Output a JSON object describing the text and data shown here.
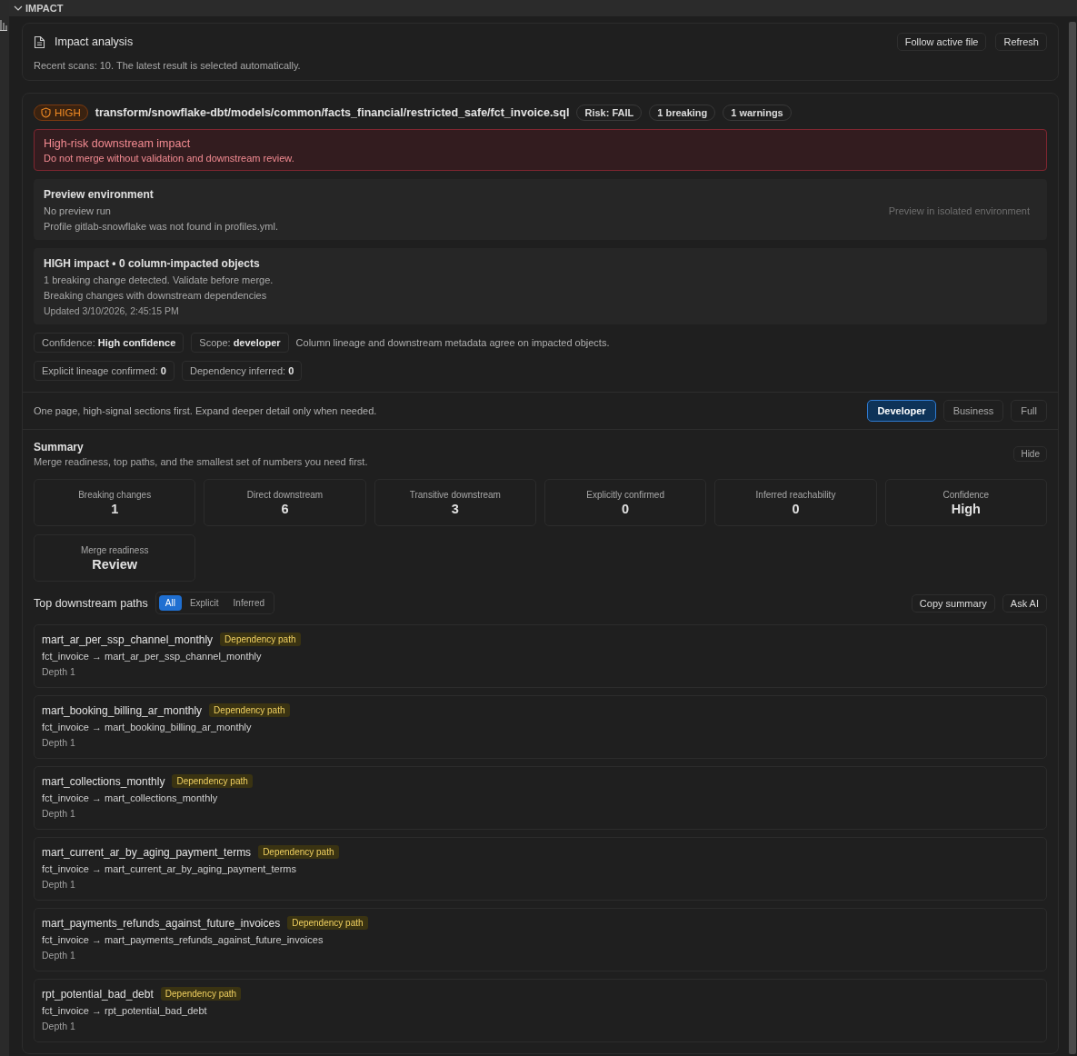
{
  "section": {
    "title": "IMPACT",
    "expanded": true
  },
  "header": {
    "title": "Impact analysis",
    "subtitle": "Recent scans: 10. The latest result is selected automatically.",
    "buttons": [
      "Follow active file",
      "Refresh"
    ]
  },
  "result": {
    "severity": "HIGH",
    "file": "transform/snowflake-dbt/models/common/facts_financial/restricted_safe/fct_invoice.sql",
    "chips": [
      "Risk: FAIL",
      "1 breaking",
      "1 warnings"
    ],
    "alert": {
      "title": "High-risk downstream impact",
      "message": "Do not merge without validation and downstream review."
    },
    "preview": {
      "title": "Preview environment",
      "status": "No preview run",
      "detail": "Profile gitlab-snowflake was not found in profiles.yml.",
      "action": "Preview in isolated environment",
      "disabled": true
    },
    "impact": {
      "title": "HIGH impact • 0 column-impacted objects",
      "lines": [
        "1 breaking change detected. Validate before merge.",
        "Breaking changes with downstream dependencies"
      ],
      "updated": "Updated 3/10/2026, 2:45:15 PM"
    },
    "fact_rows": [
      {
        "pills": [
          "Confidence: **High confidence**",
          "Scope: **developer**"
        ],
        "note": "Column lineage and downstream metadata agree on impacted objects."
      },
      {
        "pills": [
          "Explicit lineage confirmed: **0**",
          "Dependency inferred: **0**"
        ]
      }
    ]
  },
  "view": {
    "hint": "One page, high-signal sections first. Expand deeper detail only when needed.",
    "modes": [
      {
        "label": "Developer",
        "selected": true
      },
      {
        "label": "Business",
        "selected": false
      },
      {
        "label": "Full",
        "selected": false
      }
    ]
  },
  "summary": {
    "title": "Summary",
    "subtitle": "Merge readiness, top paths, and the smallest set of numbers you need first.",
    "hide_button": "Hide",
    "metrics": [
      {
        "label": "Breaking changes",
        "value": "1"
      },
      {
        "label": "Direct downstream",
        "value": "6"
      },
      {
        "label": "Transitive downstream",
        "value": "3"
      },
      {
        "label": "Explicitly confirmed",
        "value": "0"
      },
      {
        "label": "Inferred reachability",
        "value": "0"
      },
      {
        "label": "Confidence",
        "value": "High"
      },
      {
        "label": "Merge readiness",
        "value": "Review"
      }
    ]
  },
  "paths": {
    "title": "Top downstream paths",
    "filters": [
      {
        "label": "All",
        "selected": true
      },
      {
        "label": "Explicit",
        "selected": false
      },
      {
        "label": "Inferred",
        "selected": false
      }
    ],
    "actions": [
      "Copy summary",
      "Ask AI"
    ],
    "items": [
      {
        "name": "mart_ar_per_ssp_channel_monthly",
        "tag": "Dependency path",
        "route": "fct_invoice → mart_ar_per_ssp_channel_monthly",
        "depth": "Depth 1"
      },
      {
        "name": "mart_booking_billing_ar_monthly",
        "tag": "Dependency path",
        "route": "fct_invoice → mart_booking_billing_ar_monthly",
        "depth": "Depth 1"
      },
      {
        "name": "mart_collections_monthly",
        "tag": "Dependency path",
        "route": "fct_invoice → mart_collections_monthly",
        "depth": "Depth 1"
      },
      {
        "name": "mart_current_ar_by_aging_payment_terms",
        "tag": "Dependency path",
        "route": "fct_invoice → mart_current_ar_by_aging_payment_terms",
        "depth": "Depth 1"
      },
      {
        "name": "mart_payments_refunds_against_future_invoices",
        "tag": "Dependency path",
        "route": "fct_invoice → mart_payments_refunds_against_future_invoices",
        "depth": "Depth 1"
      },
      {
        "name": "rpt_potential_bad_debt",
        "tag": "Dependency path",
        "route": "fct_invoice → rpt_potential_bad_debt",
        "depth": "Depth 1"
      }
    ]
  }
}
